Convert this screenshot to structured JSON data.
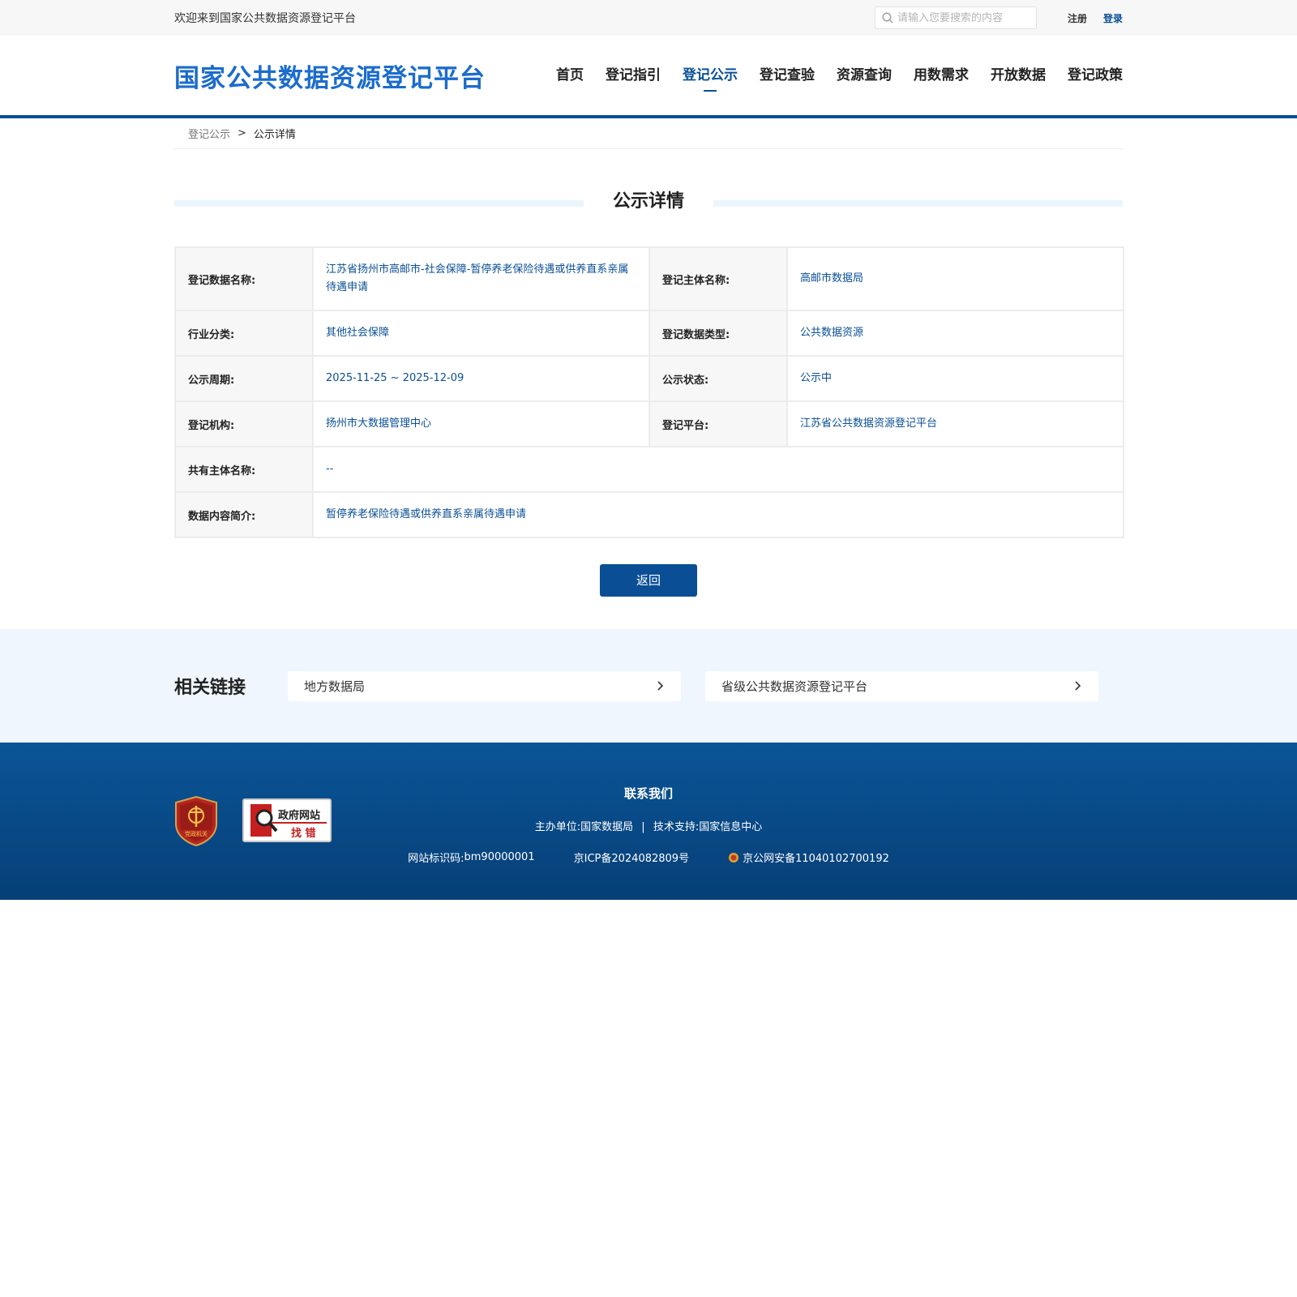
{
  "topbar": {
    "welcome": "欢迎来到国家公共数据资源登记平台",
    "search_placeholder": "请输入您要搜索的内容",
    "register": "注册",
    "login": "登录"
  },
  "header": {
    "logo": "国家公共数据资源登记平台",
    "nav": [
      "首页",
      "登记指引",
      "登记公示",
      "登记查验",
      "资源查询",
      "用数需求",
      "开放数据",
      "登记政策"
    ],
    "active_nav": "登记公示"
  },
  "breadcrumb": {
    "parent": "登记公示",
    "separator": ">",
    "current": "公示详情"
  },
  "page_title": "公示详情",
  "detail": {
    "rows": [
      {
        "k1": "登记数据名称:",
        "v1": "江苏省扬州市高邮市-社会保障-暂停养老保险待遇或供养直系亲属待遇申请",
        "k2": "登记主体名称:",
        "v2": "高邮市数据局"
      },
      {
        "k1": "行业分类:",
        "v1": "其他社会保障",
        "k2": "登记数据类型:",
        "v2": "公共数据资源"
      },
      {
        "k1": "公示周期:",
        "v1": "2025-11-25 ~ 2025-12-09",
        "k2": "公示状态:",
        "v2": "公示中"
      },
      {
        "k1": "登记机构:",
        "v1": "扬州市大数据管理中心",
        "k2": "登记平台:",
        "v2": "江苏省公共数据资源登记平台"
      }
    ],
    "wide_rows": [
      {
        "k": "共有主体名称:",
        "v": "--"
      },
      {
        "k": "数据内容简介:",
        "v": "暂停养老保险待遇或供养直系亲属待遇申请"
      }
    ]
  },
  "back_button": "返回",
  "related": {
    "title": "相关链接",
    "links": [
      "地方数据局",
      "省级公共数据资源登记平台"
    ]
  },
  "footer": {
    "title": "联系我们",
    "host_label": "主办单位:",
    "host": "国家数据局",
    "divider": "|",
    "tech_label": "技术支持:",
    "tech": "国家信息中心",
    "site_id_label": "网站标识码:",
    "site_id": "bm90000001",
    "icp": "京ICP备2024082809号",
    "police": "京公网安备11040102700192",
    "badge_text": "党政机关",
    "jiucuo_line1": "政府网站",
    "jiucuo_line2": "找 错"
  },
  "colors": {
    "brand": "#0a4f96",
    "logo": "#1b6ccc",
    "related_bg": "#eff6fd"
  }
}
